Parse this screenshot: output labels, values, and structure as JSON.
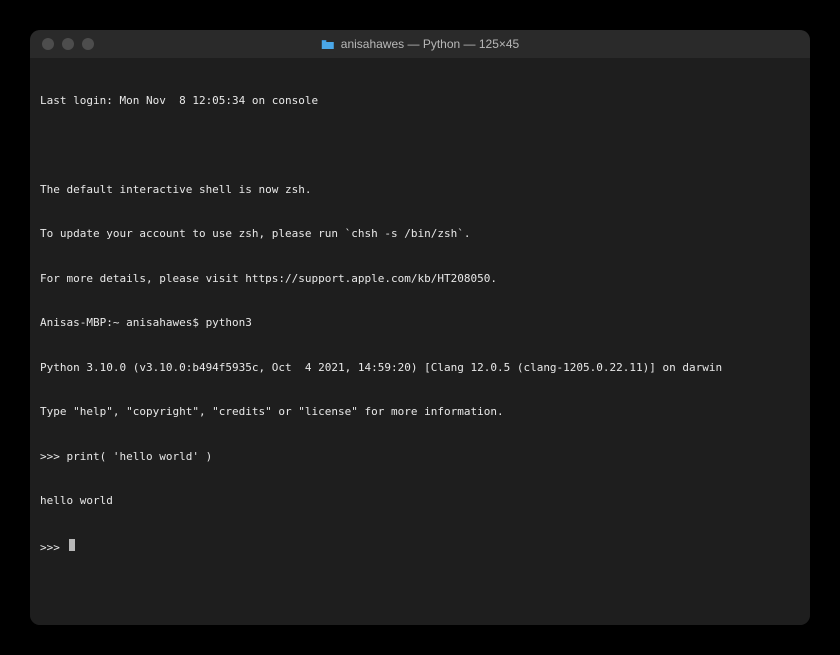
{
  "window": {
    "title": "anisahawes — Python — 125×45"
  },
  "terminal": {
    "lines": [
      "Last login: Mon Nov  8 12:05:34 on console",
      "",
      "The default interactive shell is now zsh.",
      "To update your account to use zsh, please run `chsh -s /bin/zsh`.",
      "For more details, please visit https://support.apple.com/kb/HT208050.",
      "Anisas-MBP:~ anisahawes$ python3",
      "Python 3.10.0 (v3.10.0:b494f5935c, Oct  4 2021, 14:59:20) [Clang 12.0.5 (clang-1205.0.22.11)] on darwin",
      "Type \"help\", \"copyright\", \"credits\" or \"license\" for more information.",
      ">>> print( 'hello world' )",
      "hello world"
    ],
    "prompt": ">>> "
  }
}
